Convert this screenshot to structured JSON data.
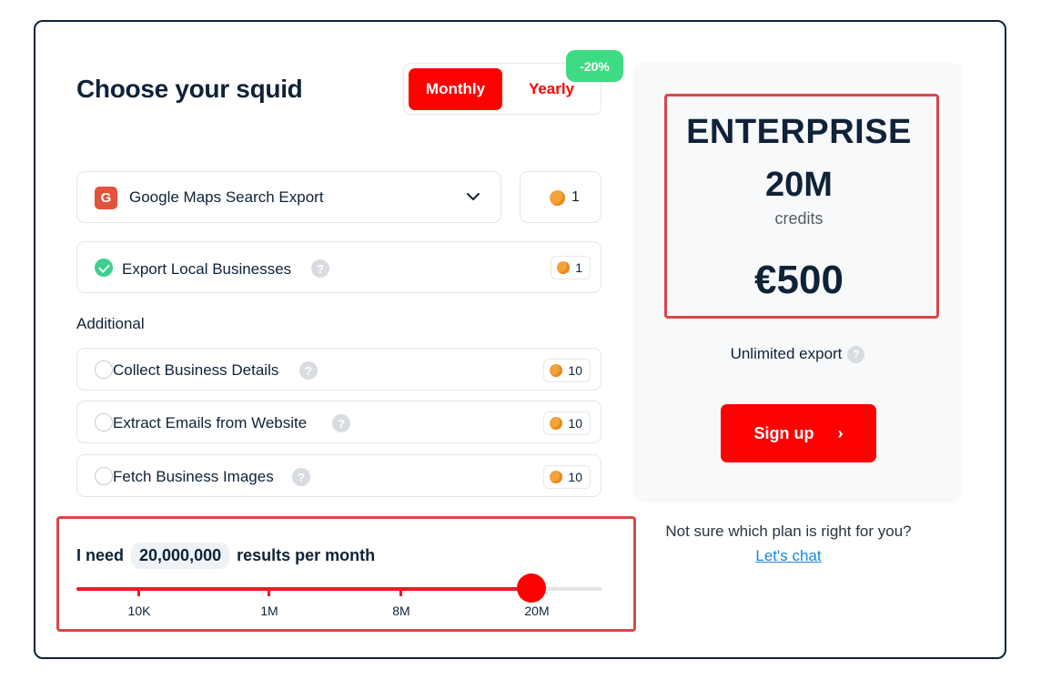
{
  "title": "Choose your squid",
  "billing": {
    "monthly_label": "Monthly",
    "yearly_label": "Yearly",
    "discount_badge": "-20%",
    "selected": "Monthly"
  },
  "service_select": {
    "icon_letter": "G",
    "label": "Google Maps Search Export",
    "credits": "1"
  },
  "base_option": {
    "label": "Export Local Businesses",
    "help": "?",
    "credits": "1",
    "checked": true
  },
  "additional_label": "Additional",
  "additional_options": [
    {
      "label": "Collect Business Details",
      "help": "?",
      "credits": "10",
      "checked": false
    },
    {
      "label": "Extract Emails from Website",
      "help": "?",
      "credits": "10",
      "checked": false
    },
    {
      "label": "Fetch Business Images",
      "help": "?",
      "credits": "10",
      "checked": false
    }
  ],
  "results": {
    "prefix": "I need",
    "value": "20,000,000",
    "suffix": "results per month",
    "slider_level": 0.867,
    "ticks": [
      "10K",
      "1M",
      "8M",
      "20M"
    ]
  },
  "plan": {
    "name": "ENTERPRISE",
    "amount": "20M",
    "unit": "credits",
    "price": "€500",
    "feature": "Unlimited export",
    "feature_help": "?",
    "cta": "Sign up",
    "cta_arrow": "›"
  },
  "help_text": "Not sure which plan is right for you?",
  "chat_link": "Let's chat",
  "colors": {
    "accent": "#ff0000",
    "discount": "#3ddc84",
    "highlight_border": "#d9464a",
    "text": "#0f2238",
    "link": "#1a86d9"
  }
}
